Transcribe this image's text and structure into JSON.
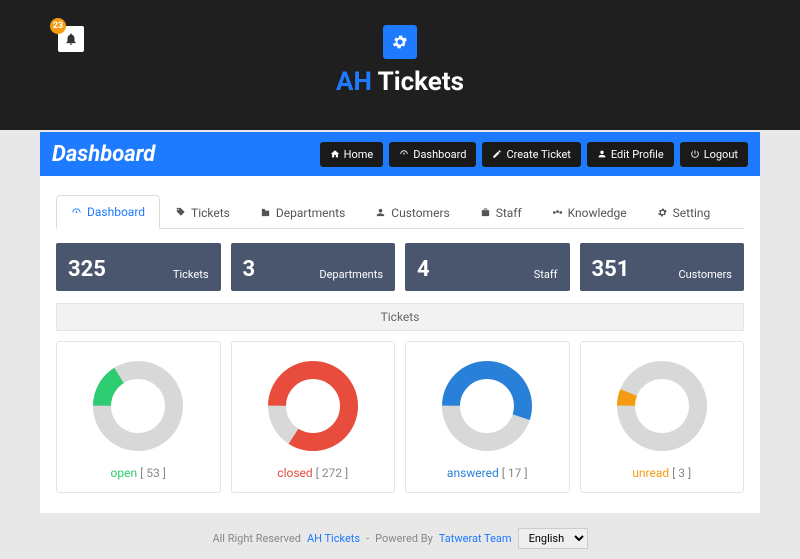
{
  "notification_count": "23",
  "brand": {
    "ah": "AH",
    "name": " Tickets"
  },
  "page_title": "Dashboard",
  "nav": {
    "home": "Home",
    "dashboard": "Dashboard",
    "create": "Create Ticket",
    "edit": "Edit Profile",
    "logout": "Logout"
  },
  "tabs": {
    "dashboard": "Dashboard",
    "tickets": "Tickets",
    "departments": "Departments",
    "customers": "Customers",
    "staff": "Staff",
    "knowledge": "Knowledge",
    "setting": "Setting"
  },
  "stats": {
    "tickets": {
      "value": "325",
      "label": "Tickets"
    },
    "departments": {
      "value": "3",
      "label": "Departments"
    },
    "staff": {
      "value": "4",
      "label": "Staff"
    },
    "customers": {
      "value": "351",
      "label": "Customers"
    }
  },
  "tickets_header": "Tickets",
  "donuts": {
    "open": {
      "label": "open",
      "value": "53",
      "color": "#2ecc71",
      "pct": 16
    },
    "closed": {
      "label": "closed",
      "value": "272",
      "color": "#e74c3c",
      "pct": 84
    },
    "answered": {
      "label": "answered",
      "value": "17",
      "color": "#2980d9",
      "pct": 55
    },
    "unread": {
      "label": "unread",
      "value": "3",
      "color": "#f39c12",
      "pct": 6
    }
  },
  "footer": {
    "reserved": "All Right Reserved",
    "link1": "AH Tickets",
    "sep": "-",
    "powered": "Powered By",
    "link2": "Tatwerat Team",
    "lang": "English"
  },
  "chart_data": [
    {
      "type": "pie",
      "title": "open",
      "categories": [
        "open",
        "other"
      ],
      "values": [
        53,
        272
      ],
      "colors": [
        "#2ecc71",
        "#d8d8d8"
      ]
    },
    {
      "type": "pie",
      "title": "closed",
      "categories": [
        "closed",
        "other"
      ],
      "values": [
        272,
        53
      ],
      "colors": [
        "#e74c3c",
        "#d8d8d8"
      ]
    },
    {
      "type": "pie",
      "title": "answered",
      "categories": [
        "answered",
        "other"
      ],
      "values": [
        17,
        14
      ],
      "colors": [
        "#2980d9",
        "#d8d8d8"
      ]
    },
    {
      "type": "pie",
      "title": "unread",
      "categories": [
        "unread",
        "other"
      ],
      "values": [
        3,
        50
      ],
      "colors": [
        "#f39c12",
        "#d8d8d8"
      ]
    }
  ]
}
